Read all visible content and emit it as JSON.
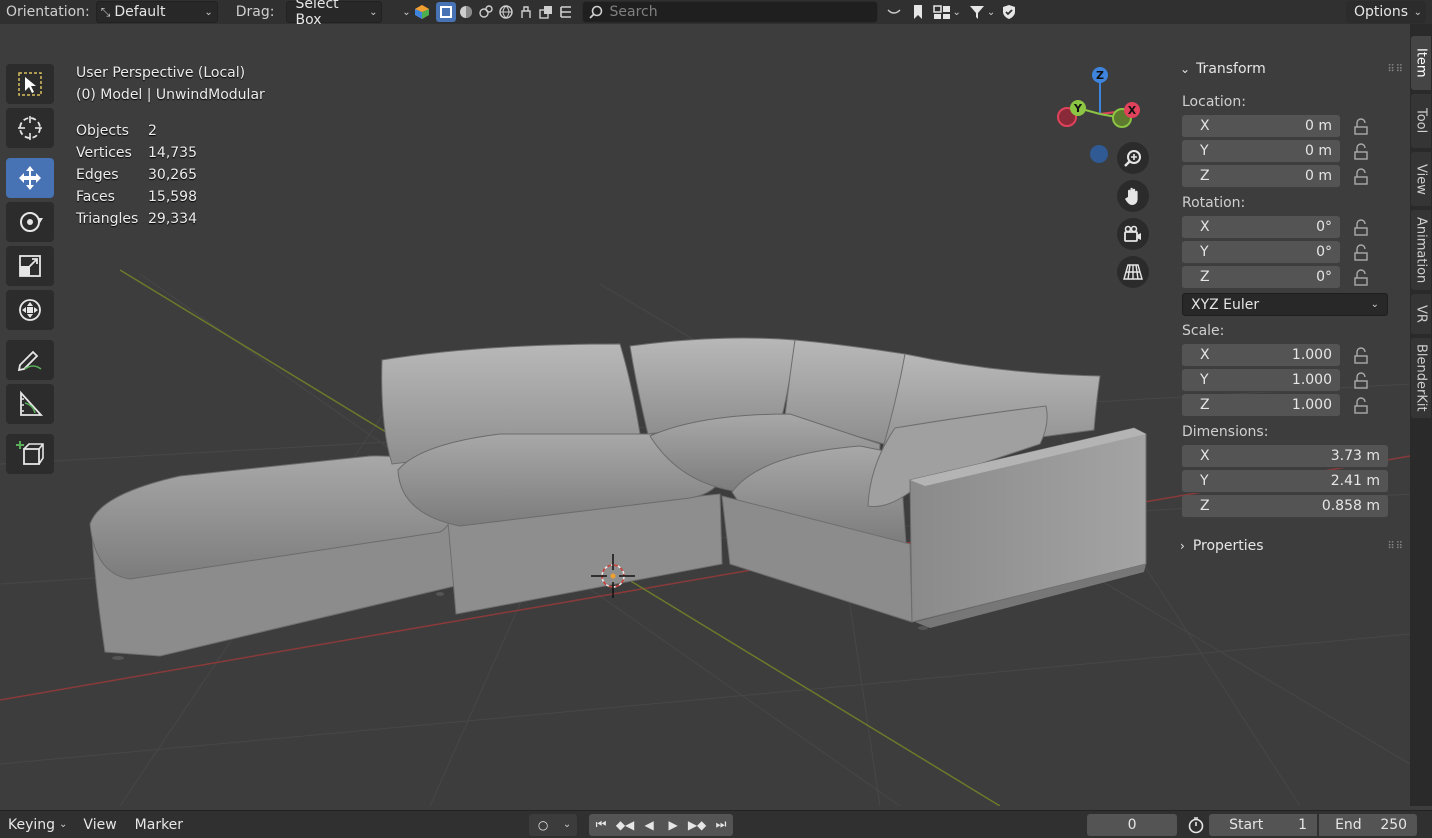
{
  "header": {
    "orientation_label": "Orientation:",
    "orientation_value": "Default",
    "drag_label": "Drag:",
    "drag_value": "Select Box",
    "search_placeholder": "Search",
    "options_label": "Options"
  },
  "overlay": {
    "view_name": "User Perspective (Local)",
    "collection": "(0) Model | UnwindModular",
    "stats": [
      {
        "label": "Objects",
        "value": "2"
      },
      {
        "label": "Vertices",
        "value": "14,735"
      },
      {
        "label": "Edges",
        "value": "30,265"
      },
      {
        "label": "Faces",
        "value": "15,598"
      },
      {
        "label": "Triangles",
        "value": "29,334"
      }
    ]
  },
  "gizmo": {
    "x": "X",
    "y": "Y",
    "z": "Z",
    "x_color": "#e0425b",
    "y_color": "#8bc543",
    "z_color": "#3e84dc"
  },
  "npanel": {
    "transform_title": "Transform",
    "location_label": "Location:",
    "location": [
      {
        "axis": "X",
        "value": "0 m"
      },
      {
        "axis": "Y",
        "value": "0 m"
      },
      {
        "axis": "Z",
        "value": "0 m"
      }
    ],
    "rotation_label": "Rotation:",
    "rotation": [
      {
        "axis": "X",
        "value": "0°"
      },
      {
        "axis": "Y",
        "value": "0°"
      },
      {
        "axis": "Z",
        "value": "0°"
      }
    ],
    "rotation_mode": "XYZ Euler",
    "scale_label": "Scale:",
    "scale": [
      {
        "axis": "X",
        "value": "1.000"
      },
      {
        "axis": "Y",
        "value": "1.000"
      },
      {
        "axis": "Z",
        "value": "1.000"
      }
    ],
    "dimensions_label": "Dimensions:",
    "dimensions": [
      {
        "axis": "X",
        "value": "3.73 m"
      },
      {
        "axis": "Y",
        "value": "2.41 m"
      },
      {
        "axis": "Z",
        "value": "0.858 m"
      }
    ],
    "properties_title": "Properties"
  },
  "sidetabs": [
    "Item",
    "Tool",
    "View",
    "Animation",
    "VR",
    "BlenderKit"
  ],
  "timeline": {
    "keying": "Keying",
    "view": "View",
    "marker": "Marker",
    "current_frame": "0",
    "start_label": "Start",
    "start_value": "1",
    "end_label": "End",
    "end_value": "250"
  },
  "colors": {
    "accent": "#4772b3",
    "x_axis_line": "#8a3a3a",
    "y_axis_line": "#6b7a2a"
  }
}
